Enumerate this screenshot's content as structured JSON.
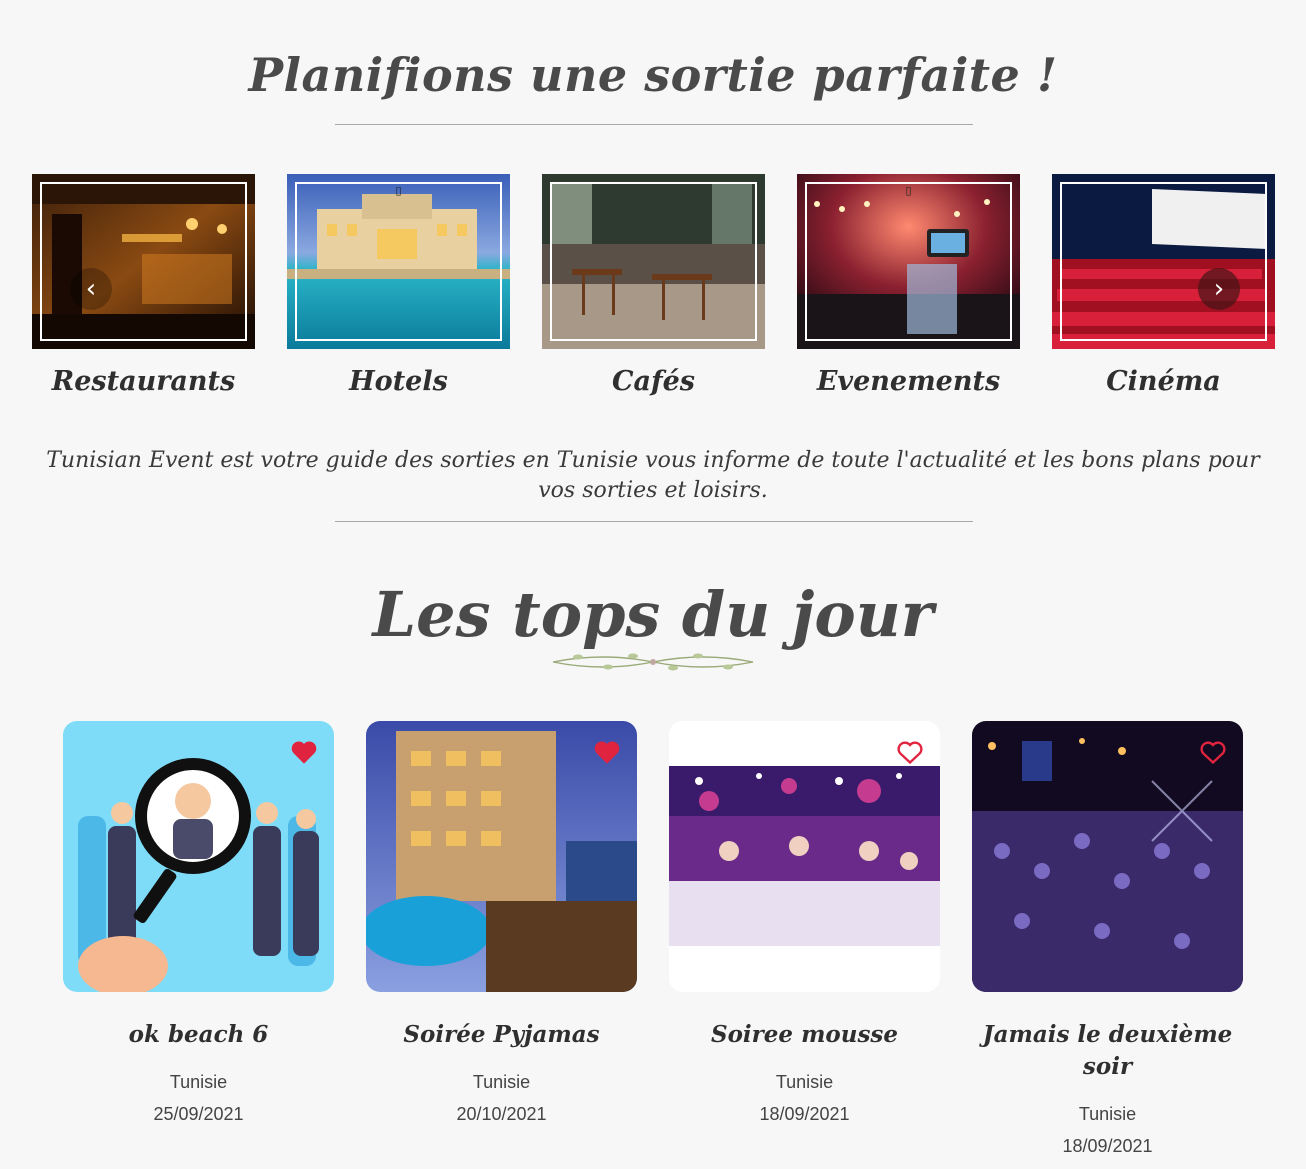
{
  "header": {
    "title": "Planifions une sortie parfaite !"
  },
  "categories": [
    {
      "label": "Restaurants"
    },
    {
      "label": "Hotels"
    },
    {
      "label": "Cafés"
    },
    {
      "label": "Evenements"
    },
    {
      "label": "Cinéma"
    }
  ],
  "intro": {
    "text": "Tunisian Event est votre guide des sorties en Tunisie vous informe de toute l'actualité et les bons plans pour vos sorties et loisirs."
  },
  "tops": {
    "title": "Les tops du jour",
    "items": [
      {
        "title": "ok beach 6",
        "location": "Tunisie",
        "date": "25/09/2021",
        "favorite": true
      },
      {
        "title": "Soirée Pyjamas",
        "location": "Tunisie",
        "date": "20/10/2021",
        "favorite": true
      },
      {
        "title": "Soiree mousse",
        "location": "Tunisie",
        "date": "18/09/2021",
        "favorite": false
      },
      {
        "title": "Jamais le deuxième soir",
        "location": "Tunisie",
        "date": "18/09/2021",
        "favorite": false
      }
    ]
  },
  "colors": {
    "background": "#f7f7f7",
    "heart": "#e0243f",
    "title": "#4a4a4a"
  },
  "icons": {
    "prev": "chevron-left-icon",
    "next": "chevron-right-icon",
    "favorite": "heart-icon"
  }
}
